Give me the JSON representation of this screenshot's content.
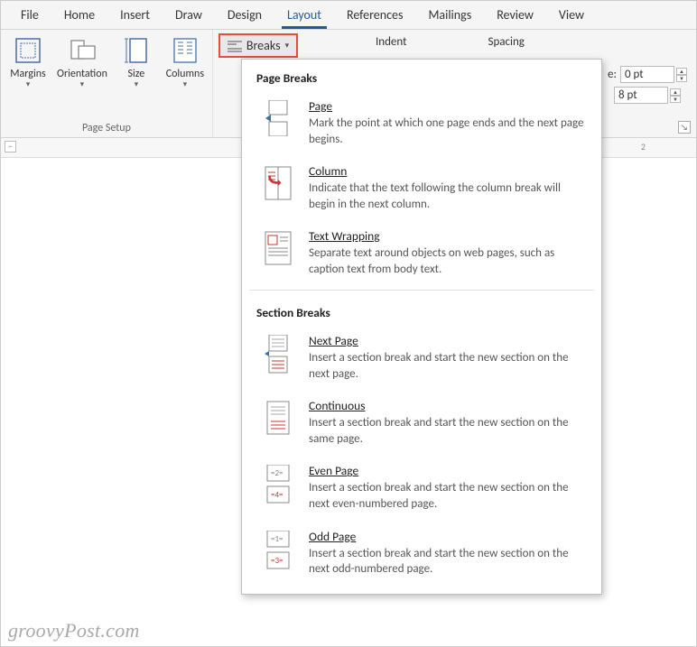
{
  "tabs": [
    "File",
    "Home",
    "Insert",
    "Draw",
    "Design",
    "Layout",
    "References",
    "Mailings",
    "Review",
    "View"
  ],
  "active_tab": "Layout",
  "ribbon": {
    "page_setup_label": "Page Setup",
    "margins": "Margins",
    "orientation": "Orientation",
    "size": "Size",
    "columns": "Columns",
    "breaks": "Breaks",
    "indent_label": "Indent",
    "spacing_label": "Spacing",
    "before_prefix": "e:",
    "before_value": "0 pt",
    "after_value": "8 pt"
  },
  "dropdown": {
    "group1": "Page Breaks",
    "items1": [
      {
        "title": "Page",
        "desc": "Mark the point at which one page ends and the next page begins."
      },
      {
        "title": "Column",
        "desc": "Indicate that the text following the column break will begin in the next column."
      },
      {
        "title": "Text Wrapping",
        "desc": "Separate text around objects on web pages, such as caption text from body text."
      }
    ],
    "group2": "Section Breaks",
    "items2": [
      {
        "title": "Next Page",
        "desc": "Insert a section break and start the new section on the next page."
      },
      {
        "title": "Continuous",
        "desc": "Insert a section break and start the new section on the same page."
      },
      {
        "title": "Even Page",
        "desc": "Insert a section break and start the new section on the next even-numbered page."
      },
      {
        "title": "Odd Page",
        "desc": "Insert a section break and start the new section on the next odd-numbered page."
      }
    ]
  },
  "ruler_number": "2",
  "watermark": "groovyPost.com"
}
